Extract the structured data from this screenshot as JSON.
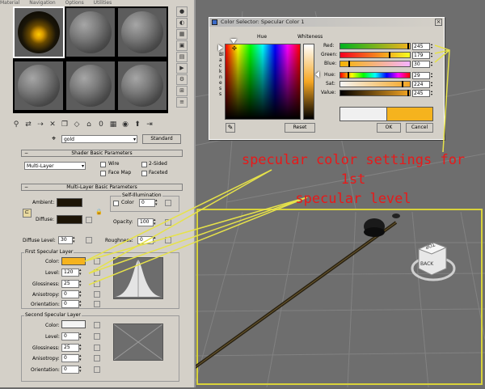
{
  "material_editor": {
    "menu": [
      "Material",
      "Navigation",
      "Options",
      "Utilities"
    ],
    "material_name": "gold",
    "material_type_button": "Standard",
    "shader_rollout": {
      "title": "Shader Basic Parameters",
      "shader": "Multi-Layer",
      "options": {
        "wire": "Wire",
        "two_sided": "2-Sided",
        "face_map": "Face Map",
        "faceted": "Faceted"
      }
    },
    "multilayer_rollout": {
      "title": "Multi-Layer Basic Parameters",
      "ambient_label": "Ambient:",
      "diffuse_label": "Diffuse:",
      "self_illum_title": "Self-Illumination",
      "self_illum_color_label": "Color",
      "self_illum_value": "0",
      "opacity_label": "Opacity:",
      "opacity_value": "100",
      "diffuse_level_label": "Diffuse Level:",
      "diffuse_level_value": "30",
      "roughness_label": "Roughness:",
      "roughness_value": "0",
      "first_specular": {
        "title": "First Specular Layer",
        "color_label": "Color:",
        "level_label": "Level:",
        "level_value": "120",
        "glossiness_label": "Glossiness:",
        "glossiness_value": "25",
        "anisotropy_label": "Anisotropy:",
        "anisotropy_value": "0",
        "orientation_label": "Orientation:",
        "orientation_value": "0"
      },
      "second_specular": {
        "title": "Second Specular Layer",
        "color_label": "Color:",
        "level_label": "Level:",
        "level_value": "0",
        "glossiness_label": "Glossiness:",
        "glossiness_value": "25",
        "anisotropy_label": "Anisotropy:",
        "anisotropy_value": "0",
        "orientation_label": "Orientation:",
        "orientation_value": "0"
      }
    }
  },
  "color_selector": {
    "title": "Color Selector: Specular Color 1",
    "hue_label": "Hue",
    "whiteness_label": "Whiteness",
    "blackness_label": "Blackness",
    "sliders": [
      {
        "label": "Red:",
        "value": "245",
        "fraction": 0.96
      },
      {
        "label": "Green:",
        "value": "179",
        "fraction": 0.7
      },
      {
        "label": "Blue:",
        "value": "30",
        "fraction": 0.12
      },
      {
        "label": "Hue:",
        "value": "29",
        "fraction": 0.11
      },
      {
        "label": "Sat:",
        "value": "224",
        "fraction": 0.88
      },
      {
        "label": "Value:",
        "value": "245",
        "fraction": 0.96
      }
    ],
    "reset_button": "Reset",
    "ok_button": "OK",
    "cancel_button": "Cancel",
    "current_color": "#f5b31e",
    "original_color": "#f0f0f0"
  },
  "viewport": {
    "nav_cube_label": "BACK",
    "nav_cube_top_label": "TOP"
  },
  "annotation": {
    "text_line1": "specular color settings for 1st",
    "text_line2": "specular level"
  },
  "colors": {
    "specular_swatch": "#f5b31e",
    "ambient_swatch": "#1c1406",
    "diffuse_swatch": "#1c1406",
    "annotation": "#e81919",
    "callout_lines": "#e6e24a"
  }
}
